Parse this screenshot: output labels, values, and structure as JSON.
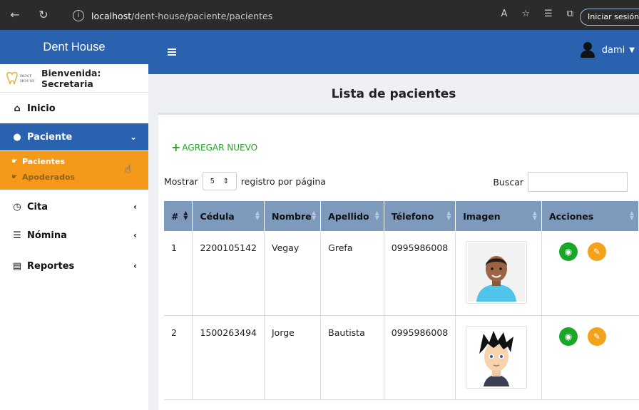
{
  "browser": {
    "url_host": "localhost",
    "url_path": "/dent-house/paciente/pacientes",
    "signin_label": "Iniciar sesión"
  },
  "app": {
    "brand": "Dent House",
    "user_name": "dami"
  },
  "sidebar": {
    "welcome": "Bienvenida: Secretaria",
    "items": [
      {
        "label": "Inicio",
        "icon": "home-icon"
      },
      {
        "label": "Paciente",
        "icon": "user-icon"
      },
      {
        "label": "Cita",
        "icon": "clock-icon"
      },
      {
        "label": "Nómina",
        "icon": "list-icon"
      },
      {
        "label": "Reportes",
        "icon": "file-icon"
      }
    ],
    "submenu": [
      {
        "label": "Pacientes"
      },
      {
        "label": "Apoderados"
      }
    ]
  },
  "main": {
    "title": "Lista de pacientes",
    "add_new": "AGREGAR NUEVO",
    "show_prefix": "Mostrar",
    "page_size": "5",
    "show_suffix": "registro por página",
    "search_label": "Buscar",
    "search_value": ""
  },
  "table": {
    "headers": [
      "#",
      "Cédula",
      "Nombre",
      "Apellido",
      "Télefono",
      "Imagen",
      "Acciones"
    ],
    "rows": [
      {
        "num": "1",
        "cedula": "2200105142",
        "nombre": "Vegay",
        "apellido": "Grefa",
        "telefono": "0995986008"
      },
      {
        "num": "2",
        "cedula": "1500263494",
        "nombre": "Jorge",
        "apellido": "Bautista",
        "telefono": "0995986008"
      }
    ]
  },
  "colors": {
    "primary": "#2a62b0",
    "submenu": "#f4991a",
    "table_header": "#7d9abd",
    "view_button": "#1aa728",
    "edit_button": "#f4a21c",
    "add_new": "#2ca02c"
  }
}
